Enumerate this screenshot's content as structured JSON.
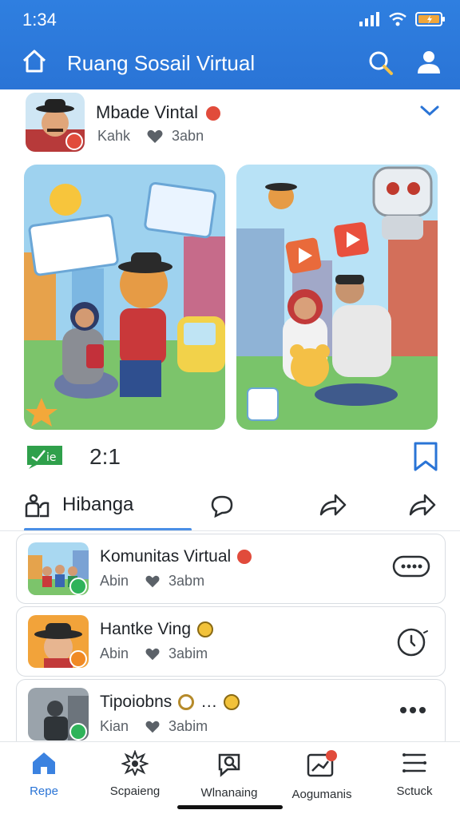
{
  "status": {
    "time": "1:34"
  },
  "header": {
    "title": "Ruang Sosail Virtual"
  },
  "post": {
    "name": "Mbade Vintal",
    "meta_left": "Kahk",
    "meta_right": "3abn",
    "count": "2:1",
    "tag_text": "ie"
  },
  "actions": {
    "primary_label": "Hibanga"
  },
  "list": [
    {
      "title": "Komunitas Virtual",
      "meta_left": "Abin",
      "meta_right": "3abm"
    },
    {
      "title": "Hantke Ving",
      "meta_left": "Abin",
      "meta_right": "3abim"
    },
    {
      "title": "Tipoiobns",
      "title_suffix": "…",
      "meta_left": "Kian",
      "meta_right": "3abim"
    }
  ],
  "nav": [
    {
      "label": "Repe",
      "icon": "home-icon"
    },
    {
      "label": "Scpaieng",
      "icon": "sparkle-icon"
    },
    {
      "label": "Wlnanaing",
      "icon": "search-chat-icon"
    },
    {
      "label": "Aogumanis",
      "icon": "chart-notification-icon"
    },
    {
      "label": "Sctuck",
      "icon": "menu-lines-icon"
    }
  ],
  "colors": {
    "accent": "#2a74d6",
    "badge_red": "#e14b3b",
    "badge_green": "#2fb35a",
    "badge_orange": "#f08a24"
  }
}
